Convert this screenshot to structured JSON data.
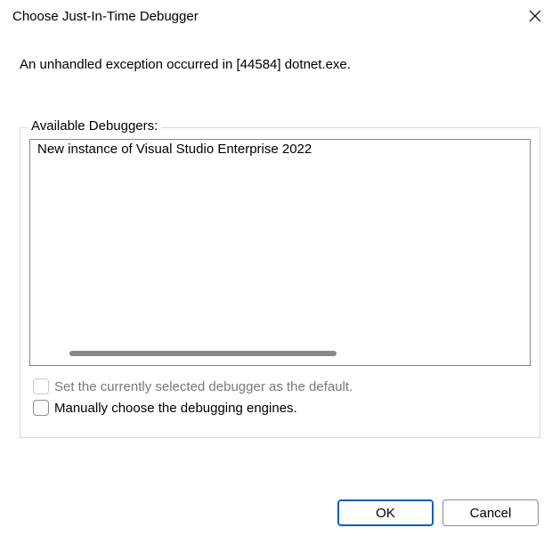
{
  "titlebar": {
    "title": "Choose Just-In-Time Debugger"
  },
  "message": "An unhandled exception occurred in [44584] dotnet.exe.",
  "group": {
    "label": "Available Debuggers:"
  },
  "debuggers": {
    "items": [
      {
        "label": "New instance of Visual Studio Enterprise 2022"
      }
    ]
  },
  "checkboxes": {
    "set_default": {
      "label": "Set the currently selected debugger as the default.",
      "checked": false,
      "enabled": false
    },
    "manual_engines": {
      "label": "Manually choose the debugging engines.",
      "checked": false,
      "enabled": true
    }
  },
  "buttons": {
    "ok": "OK",
    "cancel": "Cancel"
  }
}
